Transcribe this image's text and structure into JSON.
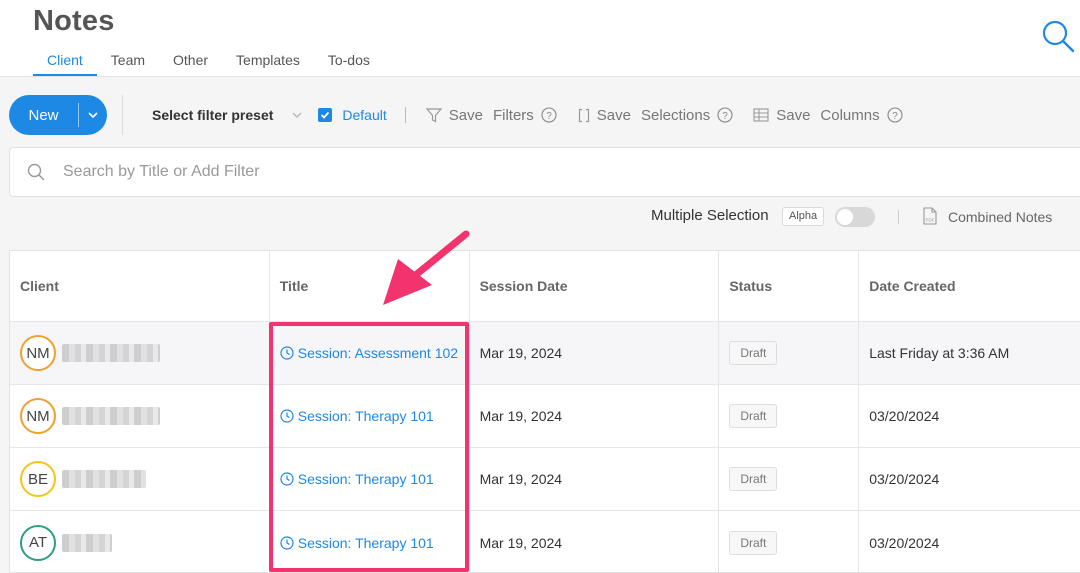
{
  "header": {
    "title": "Notes",
    "tabs": [
      {
        "label": "Client"
      },
      {
        "label": "Team"
      },
      {
        "label": "Other"
      },
      {
        "label": "Templates"
      },
      {
        "label": "To-dos"
      }
    ],
    "active_tab": "Client"
  },
  "toolbar": {
    "new_label": "New",
    "preset_label": "Select filter preset",
    "default_label": "Default",
    "save_filters": {
      "save": "Save",
      "label": "Filters"
    },
    "save_selections": {
      "save": "Save",
      "label": "Selections"
    },
    "save_columns": {
      "save": "Save",
      "label": "Columns"
    }
  },
  "search": {
    "placeholder": "Search by Title or Add Filter"
  },
  "options": {
    "multiple_selection": "Multiple Selection",
    "alpha_badge": "Alpha",
    "combined_notes": "Combined Notes"
  },
  "table": {
    "columns": [
      "Client",
      "Title",
      "Session Date",
      "Status",
      "Date Created"
    ],
    "rows": [
      {
        "initials": "NM",
        "avatar_color": "#f0a030",
        "title": "Session: Assessment 102",
        "session_date": "Mar 19, 2024",
        "status": "Draft",
        "date_created": "Last Friday at 3:36 AM"
      },
      {
        "initials": "NM",
        "avatar_color": "#f0a030",
        "title": "Session: Therapy 101",
        "session_date": "Mar 19, 2024",
        "status": "Draft",
        "date_created": "03/20/2024"
      },
      {
        "initials": "BE",
        "avatar_color": "#f5c518",
        "title": "Session: Therapy 101",
        "session_date": "Mar 19, 2024",
        "status": "Draft",
        "date_created": "03/20/2024"
      },
      {
        "initials": "AT",
        "avatar_color": "#2e9e7e",
        "title": "Session: Therapy 101",
        "session_date": "Mar 19, 2024",
        "status": "Draft",
        "date_created": "03/20/2024"
      }
    ]
  },
  "colors": {
    "accent": "#1e88e5",
    "annotation": "#f2336e"
  }
}
